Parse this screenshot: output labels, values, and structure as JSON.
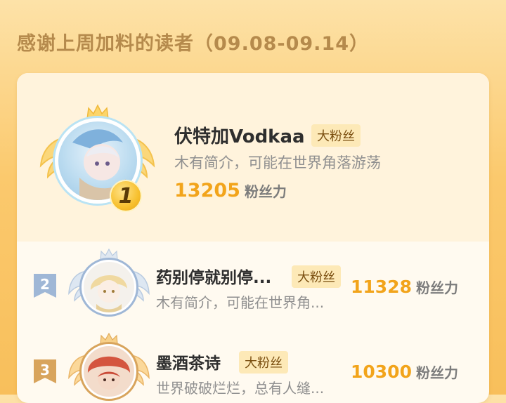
{
  "header": {
    "title": "感谢上周加料的读者（09.08-09.14）"
  },
  "champion": {
    "rank": "1",
    "name": "伏特加Vodkaa",
    "tag": "大粉丝",
    "desc": "木有简介，可能在世界角落游荡",
    "score": "13205",
    "score_unit": "粉丝力",
    "badge_color": "#f7c02e"
  },
  "rows": [
    {
      "rank": "2",
      "name": "药别停就别停...",
      "tag": "大粉丝",
      "desc": "木有简介，可能在世界角...",
      "score": "11328",
      "score_unit": "粉丝力",
      "flag_color": "#9fb7d6"
    },
    {
      "rank": "3",
      "name": "墨酒茶诗",
      "tag": "大粉丝",
      "desc": "世界破破烂烂，总有人缝...",
      "score": "10300",
      "score_unit": "粉丝力",
      "flag_color": "#d8a45c"
    }
  ],
  "colors": {
    "accent": "#f2a41b",
    "tag_bg": "#fde9b7",
    "tag_text": "#7a4e0f",
    "title": "#b58a4c"
  }
}
